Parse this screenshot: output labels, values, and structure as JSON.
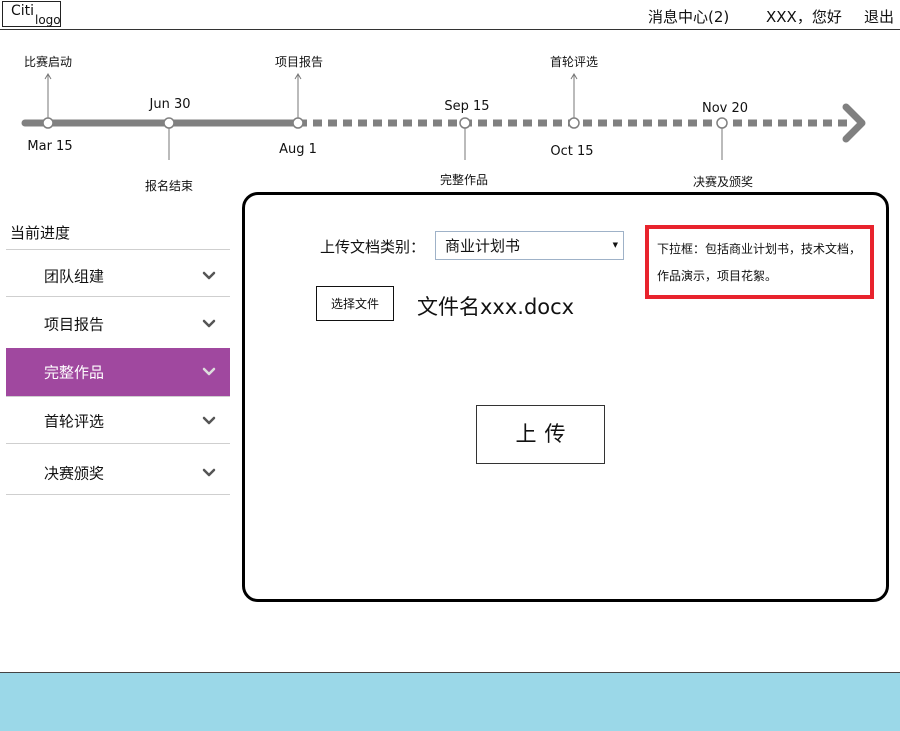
{
  "header": {
    "logo_main": "Citi",
    "logo_sub": "logo",
    "messages": "消息中心(2)",
    "greeting": "XXX，您好",
    "logout": "退出"
  },
  "timeline": {
    "dates": {
      "mar15": "Mar 15",
      "jun30": "Jun 30",
      "aug1": "Aug 1",
      "sep15": "Sep 15",
      "oct15": "Oct 15",
      "nov20": "Nov 20"
    },
    "events": {
      "kickoff": "比赛启动",
      "signup_end": "报名结束",
      "project_report": "项目报告",
      "full_work": "完整作品",
      "first_round": "首轮评选",
      "final": "决赛及颁奖"
    }
  },
  "sidebar": {
    "title": "当前进度",
    "items": [
      {
        "label": "团队组建",
        "active": false
      },
      {
        "label": "项目报告",
        "active": false
      },
      {
        "label": "完整作品",
        "active": true
      },
      {
        "label": "首轮评选",
        "active": false
      },
      {
        "label": "决赛颁奖",
        "active": false
      }
    ]
  },
  "upload": {
    "type_label": "上传文档类别：",
    "selected_type": "商业计划书",
    "choose_file": "选择文件",
    "filename": "文件名xxx.docx",
    "upload_button": "上传"
  },
  "annotation": {
    "text": "下拉框：包括商业计划书，技术文档，作品演示，项目花絮。"
  },
  "colors": {
    "active_item": "#a0489f",
    "annotation_border": "#e8232d",
    "footer": "#9bd8e8",
    "timeline": "#808080"
  },
  "icons": {
    "sidebar_chevron": "chevron-down-icon",
    "select_arrow": "caret-down-icon",
    "timeline_arrow": "arrow-right-icon"
  }
}
